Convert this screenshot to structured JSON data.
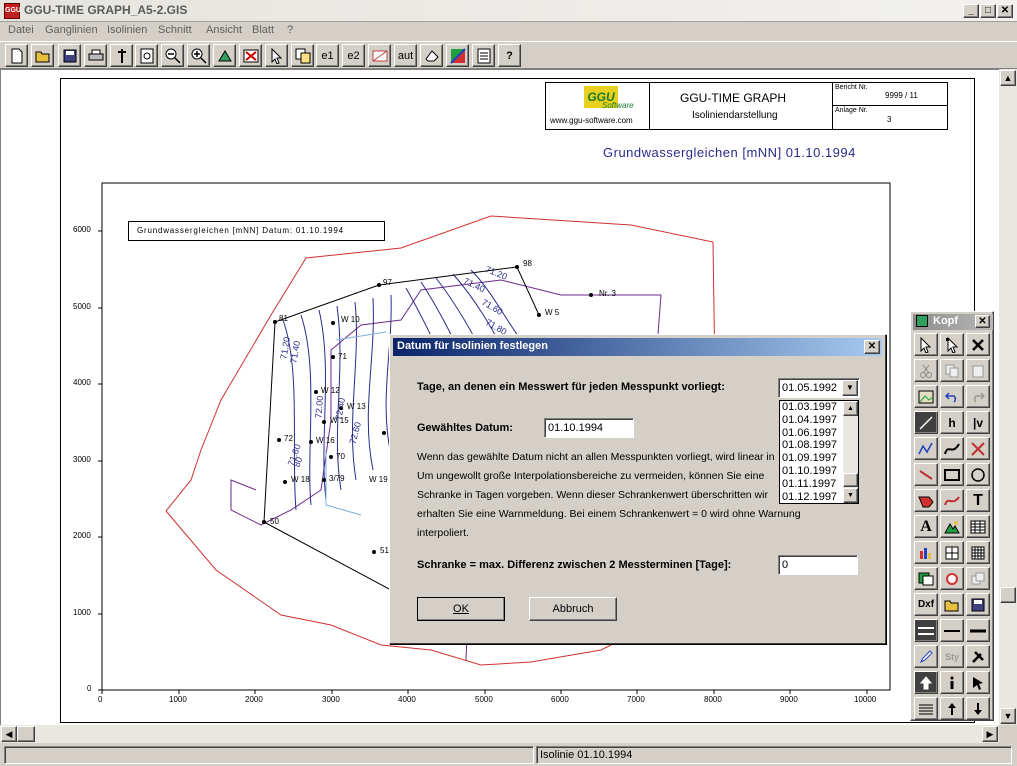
{
  "window": {
    "title": "GGU-TIME GRAPH_A5-2.GIS",
    "icon": "GGU",
    "min": "_",
    "max": "□",
    "close": "✕"
  },
  "menu": [
    "Datei",
    "Ganglinien",
    "Isolinien",
    "Schnitt",
    "Ansicht",
    "Blatt",
    "?"
  ],
  "toolbar": {
    "e1": "e1",
    "e2": "e2",
    "aut": "aut",
    "help": "?"
  },
  "header": {
    "company_url": "www.ggu-software.com",
    "logo_text": "GGU",
    "logo_sub": "Software",
    "app_name": "GGU-TIME GRAPH",
    "subtitle": "Isoliniendarstellung",
    "report_label": "Bericht Nr.",
    "report_value": "9999 / 11",
    "annex_label": "Anlage Nr.",
    "annex_value": "3"
  },
  "plot": {
    "title": "Grundwassergleichen [mNN] 01.10.1994",
    "legend_box": "Grundwassergleichen [mNN]   Datum: 01.10.1994",
    "x_ticks": [
      "0",
      "1000",
      "2000",
      "3000",
      "4000",
      "5000",
      "6000",
      "7000",
      "8000",
      "9000",
      "10000"
    ],
    "y_ticks": [
      "0",
      "1000",
      "2000",
      "3000",
      "4000",
      "5000",
      "6000"
    ],
    "points": [
      "98",
      "97",
      "Nr. 3",
      "W 5",
      "81",
      "W 10",
      "71",
      "W 12",
      "W 13",
      "W 15",
      "W 16",
      "72",
      "70",
      "3/79",
      "W 18",
      "W 19",
      "50",
      "51"
    ],
    "contour_labels": [
      "71.20",
      "71.40",
      "71.60",
      "71.80",
      "71.20",
      "71.40",
      "72.00",
      "72.40",
      "72.60",
      "71.60",
      "80"
    ]
  },
  "palette": {
    "title": "Kopf",
    "close": "✕",
    "labels": {
      "h": "h",
      "v": "|v",
      "T": "T",
      "A": "A",
      "Dxf": "Dxf",
      "Sty": "Sty"
    }
  },
  "dialog": {
    "title": "Datum für Isolinien festlegen",
    "close": "✕",
    "days_label": "Tage, an denen ein Messwert für jeden Messpunkt vorliegt:",
    "days_selected": "01.05.1992",
    "days_options": [
      "01.03.1997",
      "01.04.1997",
      "01.06.1997",
      "01.08.1997",
      "01.09.1997",
      "01.10.1997",
      "01.11.1997",
      "01.12.1997"
    ],
    "date_label": "Gewähltes Datum:",
    "date_value": "01.10.1994",
    "info_lines": [
      "Wenn das gewählte Datum nicht an allen Messpunkten vorliegt, wird linear in",
      "Um ungewollt große Interpolationsbereiche zu vermeiden, können Sie eine",
      "Schranke in Tagen vorgeben. Wenn dieser Schrankenwert überschritten wir",
      "erhalten Sie eine Warnmeldung. Bei einem Schrankenwert = 0 wird ohne Warnung",
      "interpoliert."
    ],
    "limit_label": "Schranke = max. Differenz zwischen 2 Messterminen [Tage]:",
    "limit_value": "0",
    "ok": "OK",
    "cancel": "Abbruch"
  },
  "status": {
    "text": "Isolinie  01.10.1994"
  },
  "colors": {
    "dialog_title": "#0a246a",
    "contour": "#2b2b8c",
    "boundary_red": "#d03030",
    "boundary_purple": "#6a2a8a"
  }
}
